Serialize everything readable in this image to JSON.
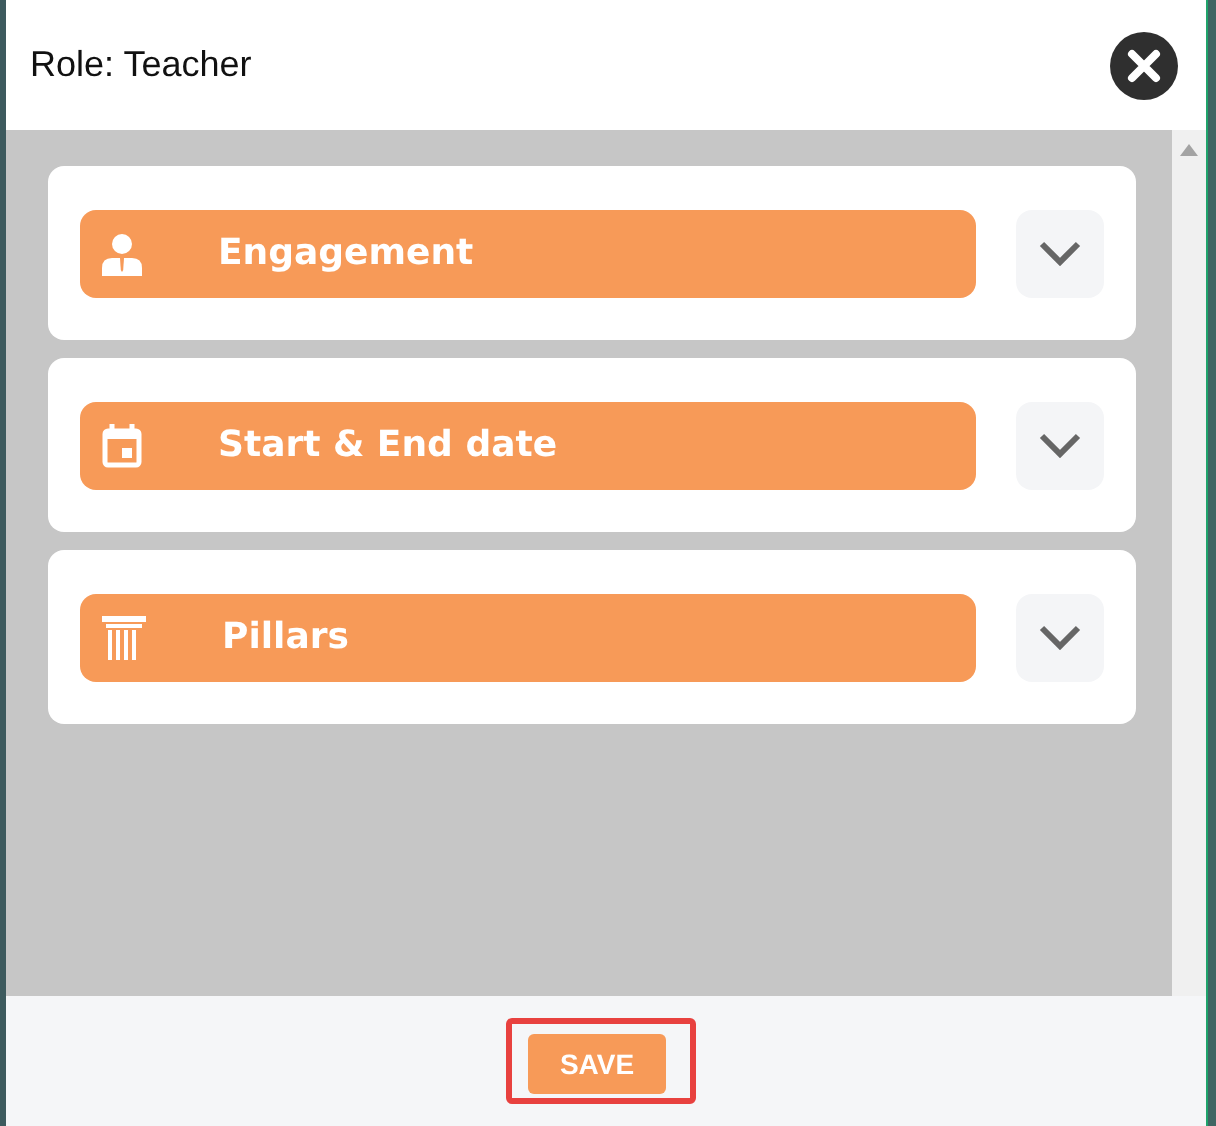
{
  "dialog": {
    "title": "Role: Teacher"
  },
  "sections": [
    {
      "kind": "person",
      "label": "Engagement",
      "expanded": false
    },
    {
      "kind": "calendar",
      "label": "Start & End date",
      "expanded": false
    },
    {
      "kind": "pillar",
      "label": "Pillars",
      "expanded": false
    }
  ],
  "footer": {
    "save_button": {
      "label": "SAVE",
      "highlighted": true
    }
  }
}
